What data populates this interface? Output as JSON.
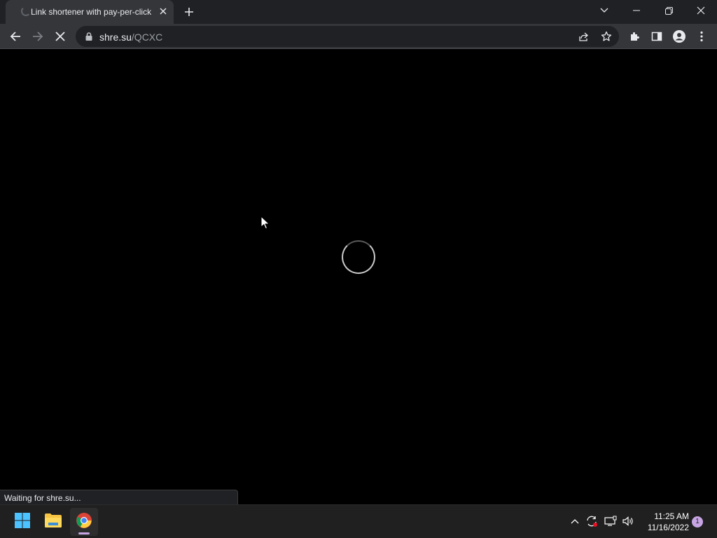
{
  "tab": {
    "title": "Link shortener with pay-per-click",
    "loading": true
  },
  "omnibox": {
    "host": "shre.su",
    "path": "/QCXC"
  },
  "status": {
    "text": "Waiting for shre.su..."
  },
  "taskbar": {
    "apps": [
      "windows-start",
      "file-explorer",
      "chrome"
    ],
    "active_app": "chrome",
    "time": "11:25 AM",
    "date": "11/16/2022",
    "notification_count": "1"
  },
  "colors": {
    "tabstrip_bg": "#202124",
    "toolbar_bg": "#35363a",
    "omnibox_bg": "#202124",
    "page_bg": "#000000",
    "taskbar_bg": "#202020",
    "accent": "#c7a5e4"
  }
}
